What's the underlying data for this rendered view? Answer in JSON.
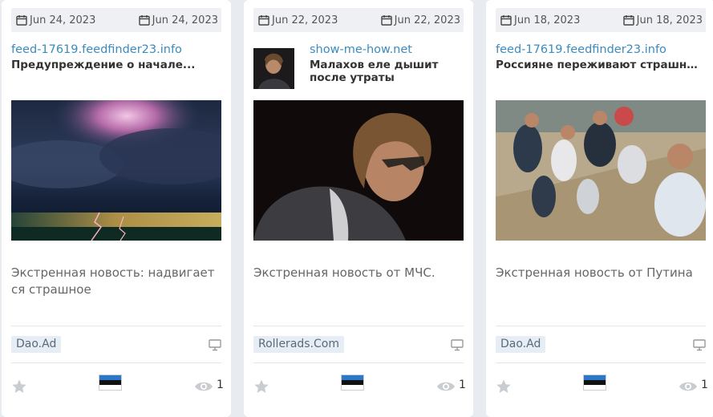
{
  "cards": [
    {
      "date_left": "Jun 24, 2023",
      "date_right": "Jun 24, 2023",
      "source": "feed-17619.feedfinder23.info",
      "headline": "Предупреждение о начале...",
      "description": "Экстренная новость: надвигает ся страшное",
      "network": "Dao.Ad",
      "views": "1",
      "image_alt": "storm-lightning-image"
    },
    {
      "date_left": "Jun 22, 2023",
      "date_right": "Jun 22, 2023",
      "source": "show-me-how.net",
      "headline": "Малахов еле дышит после утраты",
      "description": "Экстренная новость от МЧС.",
      "network": "Rollerads.Com",
      "views": "1",
      "image_alt": "man-portrait-image"
    },
    {
      "date_left": "Jun 18, 2023",
      "date_right": "Jun 18, 2023",
      "source": "feed-17619.feedfinder23.info",
      "headline": "Россияне переживают страшное!",
      "description": "Экстренная новость от Путина",
      "network": "Dao.Ad",
      "views": "1",
      "image_alt": "crowd-image"
    }
  ],
  "colors": {
    "source_link": "#3a8bbf",
    "badge_bg": "#e6edf4",
    "flag_top": "#2b77c9",
    "flag_mid": "#111111",
    "flag_bot": "#ffffff"
  },
  "icons": [
    "calendar-icon",
    "monitor-icon",
    "star-icon",
    "eye-icon",
    "estonia-flag-icon"
  ]
}
